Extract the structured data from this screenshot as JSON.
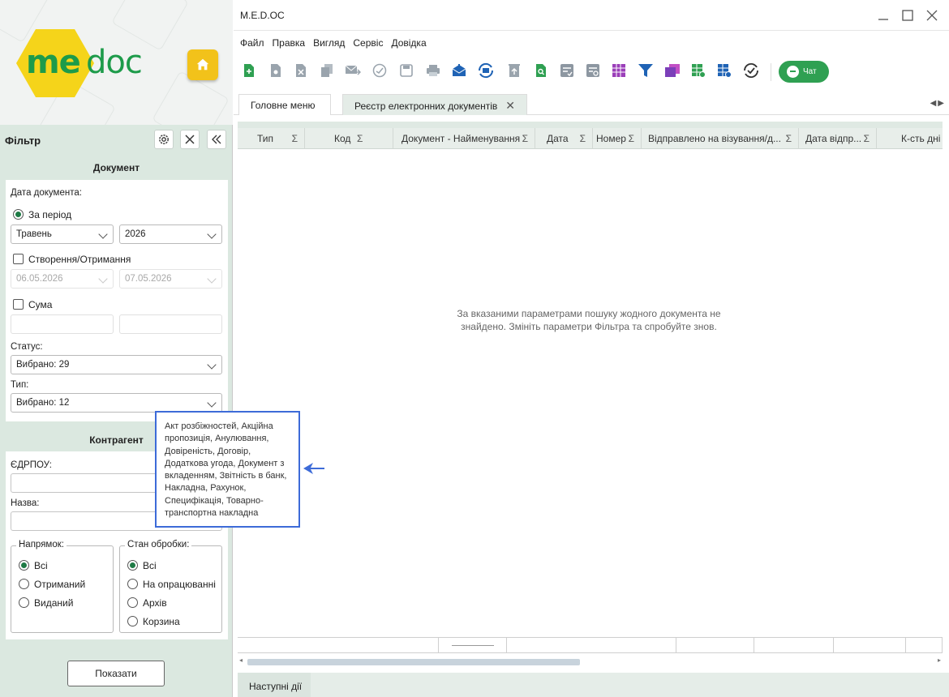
{
  "app": {
    "title": "M.E.D.OC"
  },
  "logo": {
    "left": "me",
    "right": "doc"
  },
  "menu": [
    "Файл",
    "Правка",
    "Вигляд",
    "Сервіс",
    "Довідка"
  ],
  "chat_label": "Чат",
  "tabs": [
    {
      "label": "Головне меню",
      "active": false
    },
    {
      "label": "Реєстр електронних документів",
      "active": true
    }
  ],
  "filter": {
    "title": "Фільтр",
    "document_section": "Документ",
    "doc_date_label": "Дата документа:",
    "period_label": "За період",
    "month": "Травень",
    "year": "2026",
    "creation_label": "Створення/Отримання",
    "date_from": "06.05.2026",
    "date_to": "07.05.2026",
    "sum_label": "Сума",
    "status_label": "Статус:",
    "status_value": "Вибрано: 29",
    "type_label": "Тип:",
    "type_value": "Вибрано: 12",
    "counterparty_section": "Контрагент",
    "edrpou_label": "ЄДРПОУ:",
    "name_label": "Назва:",
    "direction_label": "Напрямок:",
    "direction_options": [
      "Всі",
      "Отриманий",
      "Виданий"
    ],
    "processing_label": "Стан обробки:",
    "processing_options": [
      "Всі",
      "На опрацюванні",
      "Архів",
      "Корзина"
    ],
    "show_button": "Показати"
  },
  "tooltip_text": "Акт розбіжностей, Акційна пропозиція, Анулювання, Довіреність, Договір, Додаткова угода, Документ з вкладенням, Звітність в банк, Накладна, Рахунок, Специфікація, Товарно-транспортна накладна",
  "grid": {
    "columns": [
      "Тип",
      "Код",
      "Документ - Найменування",
      "Дата",
      "Номер",
      "Відправлено на візування/д...",
      "Дата відпр...",
      "К-сть дні"
    ],
    "sum_symbol": "Σ",
    "empty_message": "За вказаними параметрами пошуку жодного документа не знайдено. Змініть параметри Фільтра та спробуйте знов."
  },
  "next_actions": "Наступні дії",
  "colors": {
    "accent": "#1e7a45",
    "logo_yellow": "#f5d41a",
    "tooltip_border": "#3d6bd8",
    "chat_green": "#2fa052"
  }
}
